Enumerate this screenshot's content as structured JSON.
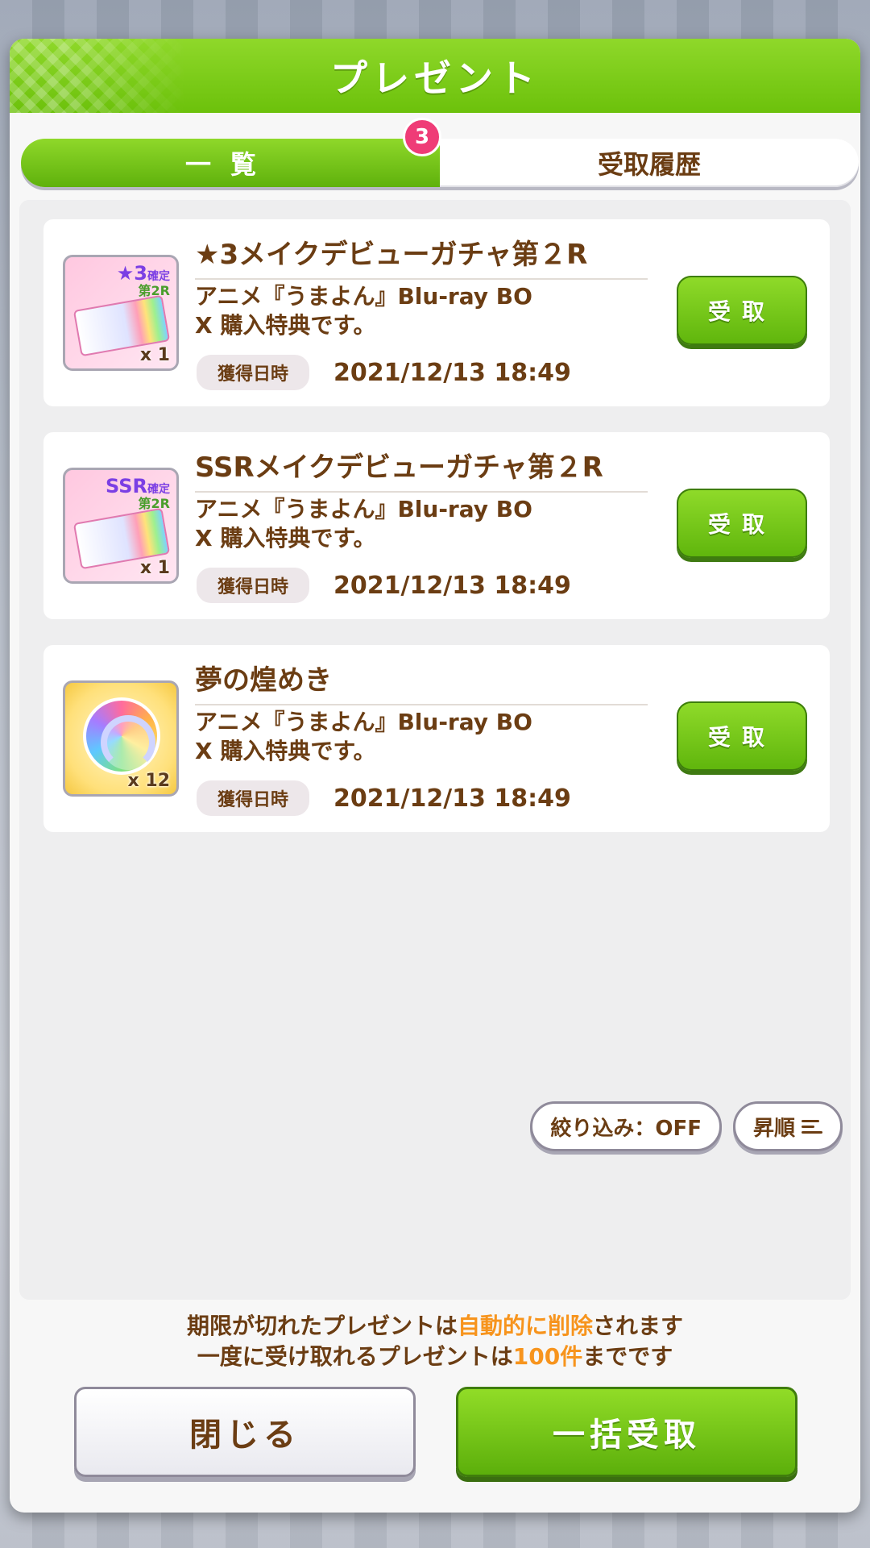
{
  "dialog": {
    "title": "プレゼント"
  },
  "tabs": [
    {
      "label": "一覧",
      "badge": "3",
      "active": true
    },
    {
      "label": "受取履歴",
      "active": false
    }
  ],
  "items": [
    {
      "title": "★3メイクデビューガチャ第２R",
      "desc_line1": "アニメ『うまよん』Blu-ray BO",
      "desc_line2": "X 購入特典です。",
      "date_label": "獲得日時",
      "date": "2021/12/13 18:49",
      "thumb_tag1": "★3",
      "thumb_tag1_sub": "確定",
      "thumb_tag2": "第2R",
      "qty": "x 1",
      "button": "受取"
    },
    {
      "title": "SSRメイクデビューガチャ第２R",
      "desc_line1": "アニメ『うまよん』Blu-ray BO",
      "desc_line2": "X 購入特典です。",
      "date_label": "獲得日時",
      "date": "2021/12/13 18:49",
      "thumb_tag1": "SSR",
      "thumb_tag1_sub": "確定",
      "thumb_tag2": "第2R",
      "qty": "x 1",
      "button": "受取"
    },
    {
      "title": "夢の煌めき",
      "desc_line1": "アニメ『うまよん』Blu-ray BO",
      "desc_line2": "X 購入特典です。",
      "date_label": "獲得日時",
      "date": "2021/12/13 18:49",
      "qty": "x 12",
      "button": "受取"
    }
  ],
  "filter": {
    "filter_label": "絞り込み：OFF",
    "sort_label": "昇順"
  },
  "notice": {
    "line1_a": "期限が切れたプレゼントは",
    "line1_hl": "自動的に削除",
    "line1_b": "されます",
    "line2_a": "一度に受け取れるプレゼントは",
    "line2_hl": "100件",
    "line2_b": "までです"
  },
  "buttons": {
    "close": "閉じる",
    "bulk_receive": "一括受取"
  },
  "colors": {
    "accent_green": "#6cc10b",
    "text_brown": "#6b3d13",
    "highlight_orange": "#f7941d",
    "badge_pink": "#ef3c77"
  }
}
